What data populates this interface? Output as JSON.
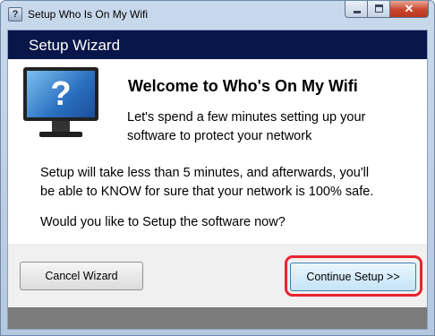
{
  "window": {
    "title": "Setup Who Is On My Wifi",
    "app_icon_glyph": "?",
    "close_glyph": "✕"
  },
  "wizard": {
    "header_title": "Setup Wizard",
    "monitor_glyph": "?",
    "welcome_title": "Welcome to Who's On My Wifi",
    "intro_lines": [
      "Let's spend a few minutes setting up your",
      "software to protect your network"
    ],
    "body_lines": [
      "Setup will take less than 5 minutes, and afterwards, you'll",
      "be able to KNOW for sure that your network is 100% safe."
    ],
    "question": "Would you like to Setup the software now?"
  },
  "buttons": {
    "cancel_label": "Cancel Wizard",
    "continue_label": "Continue Setup >>"
  },
  "colors": {
    "header_bg": "#08164a",
    "highlight": "#e8242f"
  }
}
